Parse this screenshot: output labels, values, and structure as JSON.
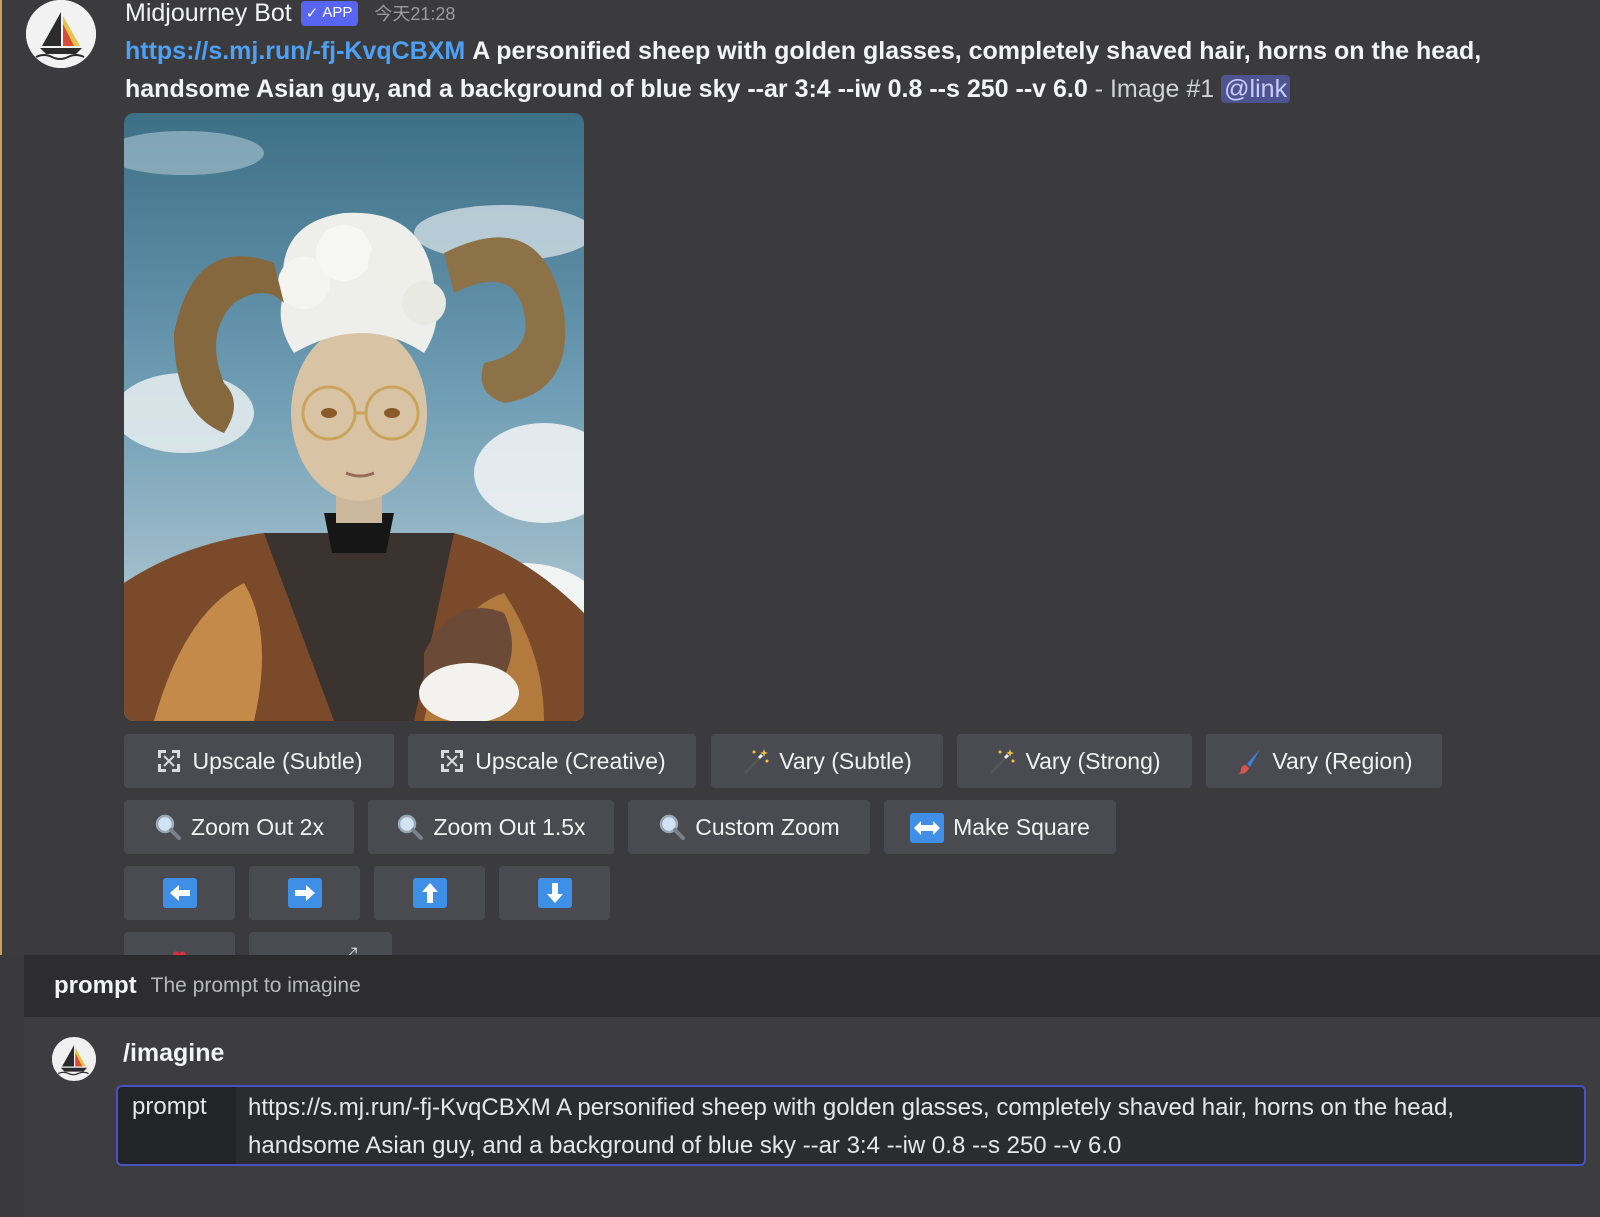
{
  "message": {
    "author": "Midjourney Bot",
    "badge": "APP",
    "timestamp": "今天21:28",
    "link": "https://s.mj.run/-fj-KvqCBXM",
    "prompt": "A personified sheep with golden glasses, completely shaved hair, horns on the head, handsome Asian guy, and a background of blue sky --ar 3:4 --iw 0.8 --s 250 --v 6.0",
    "suffix": "- Image #1",
    "mention": "@link"
  },
  "buttons": {
    "upscale_subtle": "Upscale (Subtle)",
    "upscale_creative": "Upscale (Creative)",
    "vary_subtle": "Vary (Subtle)",
    "vary_strong": "Vary (Strong)",
    "vary_region": "Vary (Region)",
    "zoom_out_2x": "Zoom Out 2x",
    "zoom_out_1_5x": "Zoom Out 1.5x",
    "custom_zoom": "Custom Zoom",
    "make_square": "Make Square"
  },
  "command": {
    "option_name": "prompt",
    "option_description": "The prompt to imagine",
    "name": "/imagine",
    "param_label": "prompt",
    "param_value": "https://s.mj.run/-fj-KvqCBXM A personified sheep with golden glasses, completely shaved hair, horns on the head, handsome Asian guy, and a background of blue sky --ar 3:4 --iw 0.8 --s 250 --v 6.0"
  },
  "colors": {
    "accent_blue": "#5865f2",
    "link": "#4ea0f5",
    "button_bg": "#4a4b50",
    "arrow_icon": "#3f8fe6"
  },
  "icons": [
    "sailboat-logo",
    "expand-icon",
    "magic-wand-icon",
    "paintbrush-icon",
    "magnifier-icon",
    "left-right-arrow-icon",
    "arrow-left-icon",
    "arrow-right-icon",
    "arrow-up-icon",
    "arrow-down-icon",
    "heart-icon",
    "external-link-icon"
  ]
}
